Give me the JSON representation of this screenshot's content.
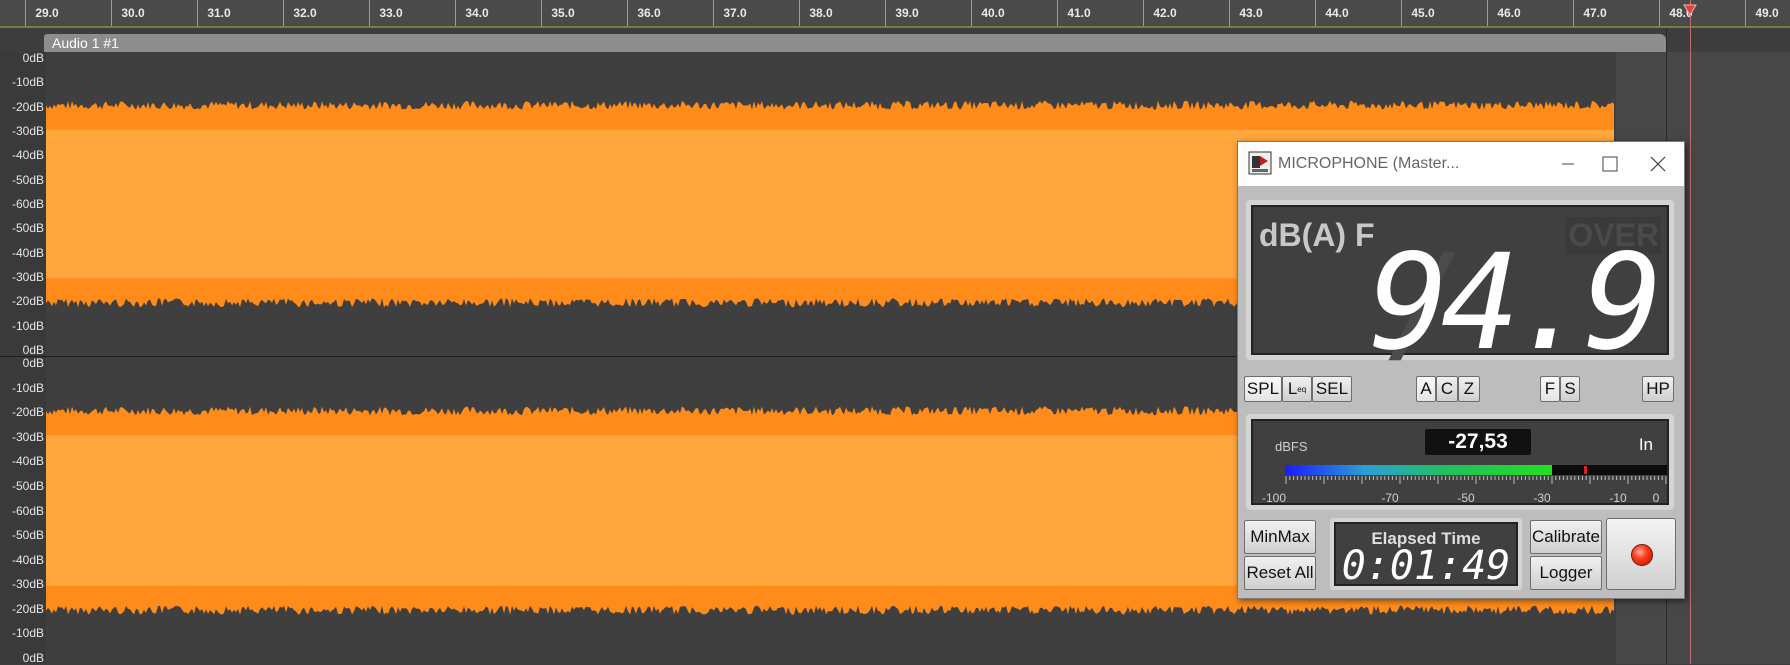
{
  "ruler": {
    "ticks": [
      "29.0",
      "30.0",
      "31.0",
      "32.0",
      "33.0",
      "34.0",
      "35.0",
      "36.0",
      "37.0",
      "38.0",
      "39.0",
      "40.0",
      "41.0",
      "42.0",
      "43.0",
      "44.0",
      "45.0",
      "46.0",
      "47.0",
      "48.0",
      "49.0"
    ]
  },
  "track": {
    "name": "Audio 1 #1",
    "waveform_color": "#ffa63c",
    "waveform_peak_color": "#ff8c1a",
    "db_scale": [
      "0dB",
      "-10dB",
      "-20dB",
      "-30dB",
      "-40dB",
      "-50dB",
      "-60dB",
      "-50dB",
      "-40dB",
      "-30dB",
      "-20dB",
      "-10dB",
      "0dB"
    ]
  },
  "meter": {
    "window_title": "MICROPHONE (Master...",
    "weighting": "dB(A) F",
    "over": "OVER",
    "value": "94.9",
    "mode_buttons": {
      "spl": "SPL",
      "leq_main": "L",
      "leq_sub": "eq",
      "sel": "SEL"
    },
    "weight_buttons": {
      "a": "A",
      "c": "C",
      "z": "Z"
    },
    "time_buttons": {
      "f": "F",
      "s": "S"
    },
    "hp": "HP",
    "dbfs_label": "dBFS",
    "dbfs_value": "-27,53",
    "input_label": "In",
    "input_level_dbfs": -27.53,
    "bar_scale": [
      "-100",
      "-70",
      "-50",
      "-30",
      "-10",
      "0"
    ],
    "buttons": {
      "minmax": "MinMax",
      "reset_all": "Reset All",
      "calibrate": "Calibrate",
      "logger": "Logger"
    },
    "elapsed_label": "Elapsed Time",
    "elapsed_value": "0:01:49"
  }
}
